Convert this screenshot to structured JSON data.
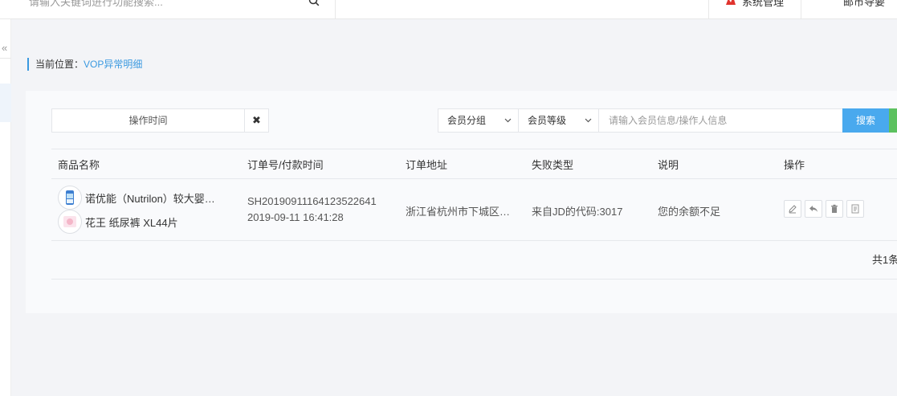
{
  "header": {
    "search_placeholder": "请输入关键词进行功能搜索...",
    "system_label": "系统管理",
    "user_label": "邮市导要"
  },
  "sidebar": {
    "collapse_glyph": "«"
  },
  "breadcrumb": {
    "label": "当前位置：",
    "current": "VOP异常明细"
  },
  "filters": {
    "date_label": "操作时间",
    "clear_glyph": "✖",
    "member_group": "会员分组",
    "member_level": "会员等级",
    "keyword_placeholder": "请输入会员信息/操作人信息",
    "search_label": "搜索"
  },
  "table": {
    "columns": [
      "商品名称",
      "订单号/付款时间",
      "订单地址",
      "失败类型",
      "说明",
      "操作"
    ],
    "rows": [
      {
        "products": [
          "诺优能（Nutrilon）较大婴…",
          "花王 纸尿裤 XL44片"
        ],
        "order_no": "SH20190911164123522641",
        "pay_time": "2019-09-11 16:41:28",
        "address": "浙江省杭州市下城区…",
        "fail_type": "来自JD的代码:3017",
        "note": "您的余额不足"
      }
    ],
    "total": "共1条"
  },
  "colors": {
    "accent": "#3a99e0",
    "search_button": "#49a9ee",
    "green_button": "#5cc15f"
  }
}
